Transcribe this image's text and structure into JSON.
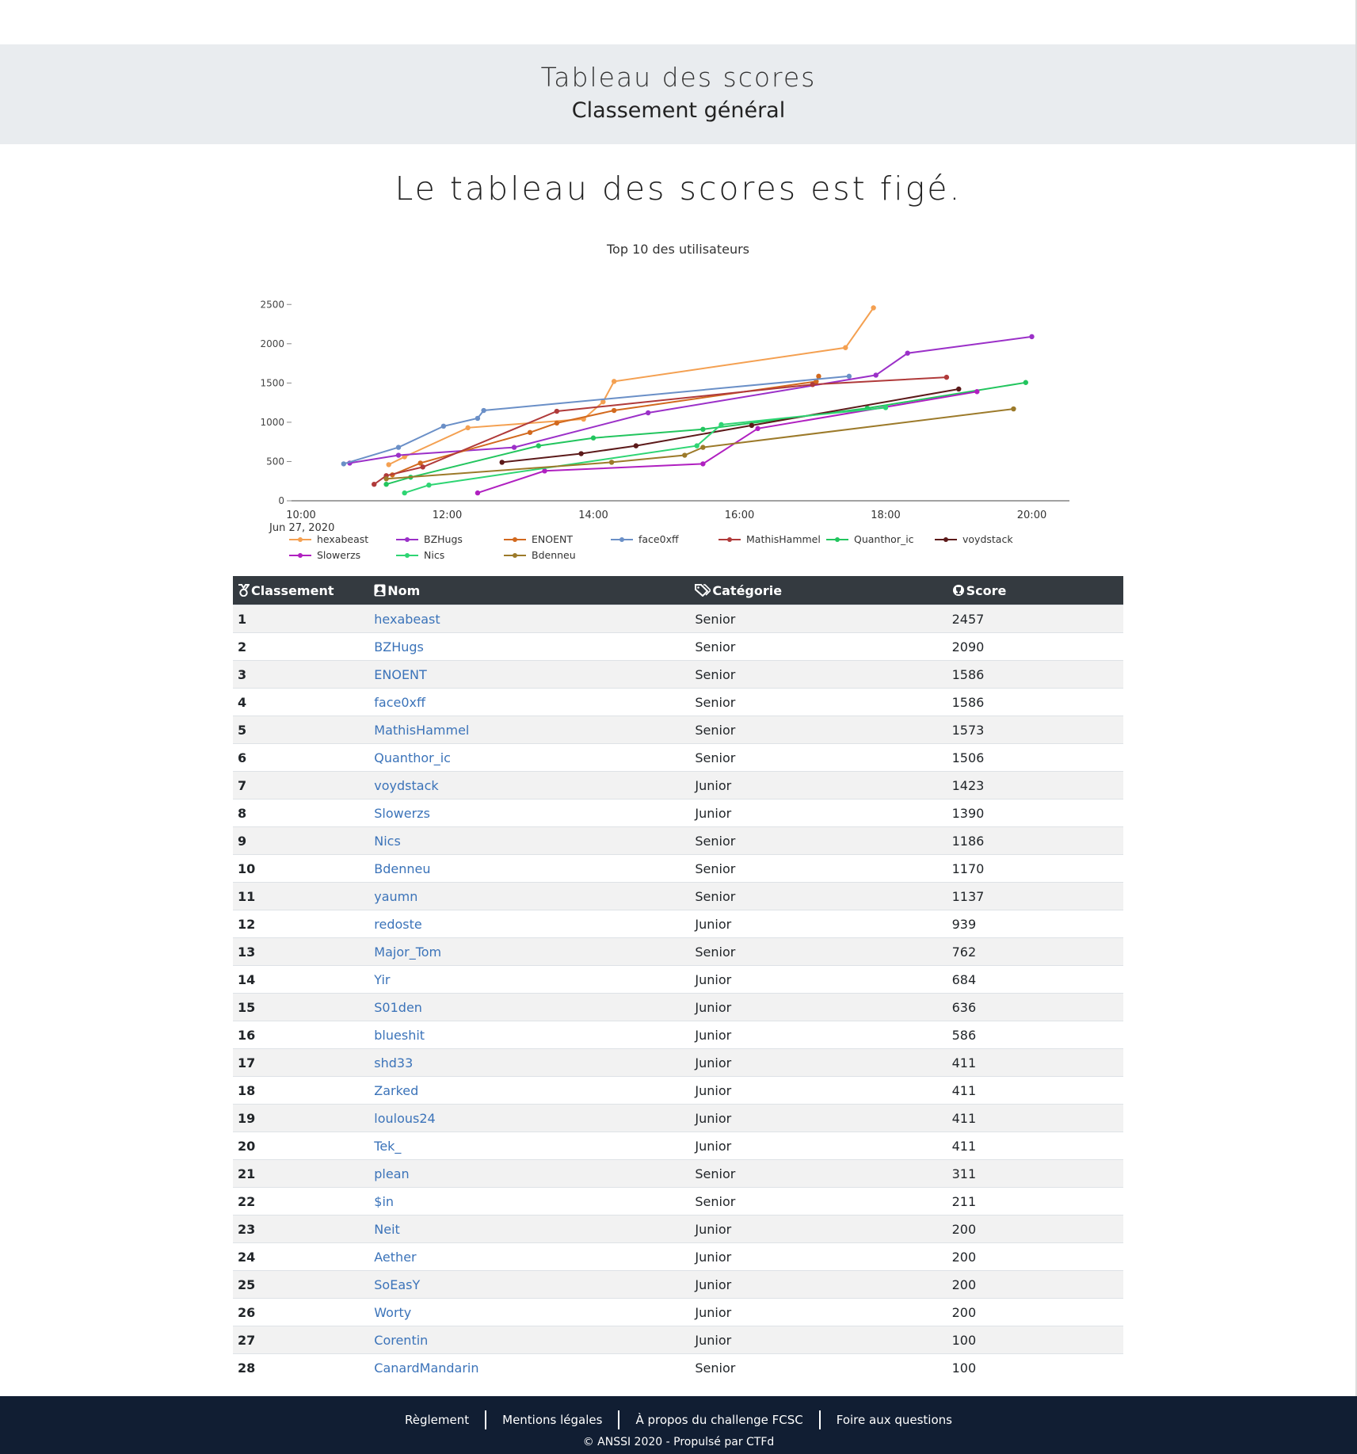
{
  "header": {
    "title": "Tableau des scores",
    "subtitle": "Classement général"
  },
  "notice": "Le tableau des scores est figé.",
  "chart_data": {
    "type": "line",
    "title": "Top 10 des utilisateurs",
    "x_start_label": "Jun 27, 2020",
    "x_ticks": [
      "10:00",
      "12:00",
      "14:00",
      "16:00",
      "18:00",
      "20:00"
    ],
    "y_ticks": [
      0,
      500,
      1000,
      1500,
      2000,
      2500
    ],
    "ylim": [
      0,
      2500
    ],
    "xlim": [
      "10:00",
      "20:30"
    ],
    "legend_position": "bottom",
    "series": [
      {
        "name": "hexabeast",
        "color": "#f4a051",
        "points": [
          [
            "11:12",
            460
          ],
          [
            "11:25",
            560
          ],
          [
            "12:17",
            930
          ],
          [
            "13:52",
            1040
          ],
          [
            "14:08",
            1260
          ],
          [
            "14:17",
            1520
          ],
          [
            "17:27",
            1950
          ],
          [
            "17:50",
            2457
          ]
        ]
      },
      {
        "name": "BZHugs",
        "color": "#9b30c8",
        "points": [
          [
            "10:40",
            480
          ],
          [
            "11:20",
            580
          ],
          [
            "12:55",
            680
          ],
          [
            "14:45",
            1120
          ],
          [
            "17:52",
            1600
          ],
          [
            "18:18",
            1880
          ],
          [
            "20:00",
            2090
          ]
        ]
      },
      {
        "name": "ENOENT",
        "color": "#d2691e",
        "points": [
          [
            "11:15",
            330
          ],
          [
            "11:38",
            480
          ],
          [
            "13:08",
            870
          ],
          [
            "13:30",
            990
          ],
          [
            "14:17",
            1150
          ],
          [
            "17:03",
            1520
          ],
          [
            "17:05",
            1586
          ]
        ]
      },
      {
        "name": "face0xff",
        "color": "#6a8fc7",
        "points": [
          [
            "10:35",
            470
          ],
          [
            "11:20",
            680
          ],
          [
            "11:57",
            950
          ],
          [
            "12:25",
            1050
          ],
          [
            "12:30",
            1150
          ],
          [
            "17:30",
            1586
          ]
        ]
      },
      {
        "name": "MathisHammel",
        "color": "#b03a3a",
        "points": [
          [
            "11:00",
            210
          ],
          [
            "11:10",
            320
          ],
          [
            "11:40",
            430
          ],
          [
            "13:30",
            1140
          ],
          [
            "17:00",
            1480
          ],
          [
            "18:50",
            1573
          ]
        ]
      },
      {
        "name": "Quanthor_ic",
        "color": "#22c55e",
        "points": [
          [
            "11:10",
            210
          ],
          [
            "11:30",
            300
          ],
          [
            "13:15",
            700
          ],
          [
            "14:00",
            800
          ],
          [
            "15:30",
            910
          ],
          [
            "17:45",
            1180
          ],
          [
            "19:55",
            1506
          ]
        ]
      },
      {
        "name": "voydstack",
        "color": "#5c1a1a",
        "points": [
          [
            "12:45",
            490
          ],
          [
            "13:50",
            600
          ],
          [
            "14:35",
            700
          ],
          [
            "16:10",
            960
          ],
          [
            "19:00",
            1423
          ]
        ]
      },
      {
        "name": "Slowerzs",
        "color": "#b020c0",
        "points": [
          [
            "12:25",
            100
          ],
          [
            "13:20",
            380
          ],
          [
            "15:30",
            470
          ],
          [
            "16:15",
            920
          ],
          [
            "19:15",
            1390
          ]
        ]
      },
      {
        "name": "Nics",
        "color": "#2ed573",
        "points": [
          [
            "11:25",
            100
          ],
          [
            "11:45",
            200
          ],
          [
            "15:25",
            700
          ],
          [
            "15:45",
            970
          ],
          [
            "18:00",
            1186
          ]
        ]
      },
      {
        "name": "Bdenneu",
        "color": "#9c7a2a",
        "points": [
          [
            "11:10",
            280
          ],
          [
            "14:15",
            490
          ],
          [
            "15:15",
            580
          ],
          [
            "15:30",
            680
          ],
          [
            "19:45",
            1170
          ]
        ]
      }
    ]
  },
  "table": {
    "headers": {
      "rank": "Classement",
      "name": "Nom",
      "category": "Catégorie",
      "score": "Score"
    },
    "rows": [
      {
        "rank": "1",
        "name": "hexabeast",
        "category": "Senior",
        "score": "2457"
      },
      {
        "rank": "2",
        "name": "BZHugs",
        "category": "Senior",
        "score": "2090"
      },
      {
        "rank": "3",
        "name": "ENOENT",
        "category": "Senior",
        "score": "1586"
      },
      {
        "rank": "4",
        "name": "face0xff",
        "category": "Senior",
        "score": "1586"
      },
      {
        "rank": "5",
        "name": "MathisHammel",
        "category": "Senior",
        "score": "1573"
      },
      {
        "rank": "6",
        "name": "Quanthor_ic",
        "category": "Senior",
        "score": "1506"
      },
      {
        "rank": "7",
        "name": "voydstack",
        "category": "Junior",
        "score": "1423"
      },
      {
        "rank": "8",
        "name": "Slowerzs",
        "category": "Junior",
        "score": "1390"
      },
      {
        "rank": "9",
        "name": "Nics",
        "category": "Senior",
        "score": "1186"
      },
      {
        "rank": "10",
        "name": "Bdenneu",
        "category": "Senior",
        "score": "1170"
      },
      {
        "rank": "11",
        "name": "yaumn",
        "category": "Senior",
        "score": "1137"
      },
      {
        "rank": "12",
        "name": "redoste",
        "category": "Junior",
        "score": "939"
      },
      {
        "rank": "13",
        "name": "Major_Tom",
        "category": "Senior",
        "score": "762"
      },
      {
        "rank": "14",
        "name": "Yir",
        "category": "Junior",
        "score": "684"
      },
      {
        "rank": "15",
        "name": "S01den",
        "category": "Junior",
        "score": "636"
      },
      {
        "rank": "16",
        "name": "blueshit",
        "category": "Junior",
        "score": "586"
      },
      {
        "rank": "17",
        "name": "shd33",
        "category": "Junior",
        "score": "411"
      },
      {
        "rank": "18",
        "name": "Zarked",
        "category": "Junior",
        "score": "411"
      },
      {
        "rank": "19",
        "name": "loulous24",
        "category": "Junior",
        "score": "411"
      },
      {
        "rank": "20",
        "name": "Tek_",
        "category": "Junior",
        "score": "411"
      },
      {
        "rank": "21",
        "name": "plean",
        "category": "Senior",
        "score": "311"
      },
      {
        "rank": "22",
        "name": "$in",
        "category": "Senior",
        "score": "211"
      },
      {
        "rank": "23",
        "name": "Neit",
        "category": "Junior",
        "score": "200"
      },
      {
        "rank": "24",
        "name": "Aether",
        "category": "Junior",
        "score": "200"
      },
      {
        "rank": "25",
        "name": "SoEasY",
        "category": "Junior",
        "score": "200"
      },
      {
        "rank": "26",
        "name": "Worty",
        "category": "Junior",
        "score": "200"
      },
      {
        "rank": "27",
        "name": "Corentin",
        "category": "Junior",
        "score": "100"
      },
      {
        "rank": "28",
        "name": "CanardMandarin",
        "category": "Senior",
        "score": "100"
      }
    ]
  },
  "footer": {
    "links": [
      "Règlement",
      "Mentions légales",
      "À propos du challenge FCSC",
      "Foire aux questions"
    ],
    "copyright": "© ANSSI 2020 - Propulsé par CTFd"
  },
  "icons": {
    "rank": "medal-icon",
    "name": "user-icon",
    "category": "tags-icon",
    "score": "trophy-icon"
  }
}
